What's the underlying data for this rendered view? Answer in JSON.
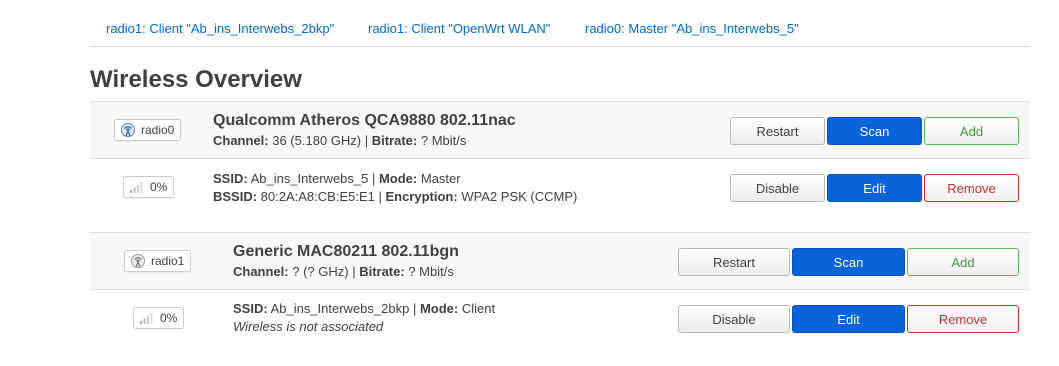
{
  "tabs": [
    "radio1: Client \"Ab_ins_Interwebs_2bkp\"",
    "radio1: Client \"OpenWrt WLAN\"",
    "radio0: Master \"Ab_ins_Interwebs_5\""
  ],
  "page_title": "Wireless Overview",
  "devices": [
    {
      "badge": "radio0",
      "name": "Qualcomm Atheros QCA9880 802.11nac",
      "channel_label": "Channel:",
      "channel_value": " 36 (5.180 GHz) | ",
      "bitrate_label": "Bitrate:",
      "bitrate_value": " ? Mbit/s",
      "buttons": {
        "restart": "Restart",
        "scan": "Scan",
        "add": "Add"
      },
      "network": {
        "signal": "0%",
        "ssid_label": "SSID:",
        "ssid_value": " Ab_ins_Interwebs_5 | ",
        "mode_label": "Mode:",
        "mode_value": " Master",
        "bssid_label": "BSSID:",
        "bssid_value": " 80:2A:A8:CB:E5:E1 | ",
        "enc_label": "Encryption:",
        "enc_value": " WPA2 PSK (CCMP)",
        "buttons": {
          "disable": "Disable",
          "edit": "Edit",
          "remove": "Remove"
        }
      }
    },
    {
      "badge": "radio1",
      "name": "Generic MAC80211 802.11bgn",
      "channel_label": "Channel:",
      "channel_value": " ? (? GHz) | ",
      "bitrate_label": "Bitrate:",
      "bitrate_value": " ? Mbit/s",
      "buttons": {
        "restart": "Restart",
        "scan": "Scan",
        "add": "Add"
      },
      "network": {
        "signal": "0%",
        "ssid_label": "SSID:",
        "ssid_value": " Ab_ins_Interwebs_2bkp | ",
        "mode_label": "Mode:",
        "mode_value": " Client",
        "status": "Wireless is not associated",
        "buttons": {
          "disable": "Disable",
          "edit": "Edit",
          "remove": "Remove"
        }
      }
    }
  ],
  "colors": {
    "link": "#0069d6",
    "primary": "#0b63d9",
    "add": "#3a9a3a",
    "remove": "#c9302c",
    "row_bg": "#f8f8f8"
  },
  "icons": {
    "radio_badge": "wireless-radio-icon",
    "signal_badge": "signal-bars-icon"
  }
}
